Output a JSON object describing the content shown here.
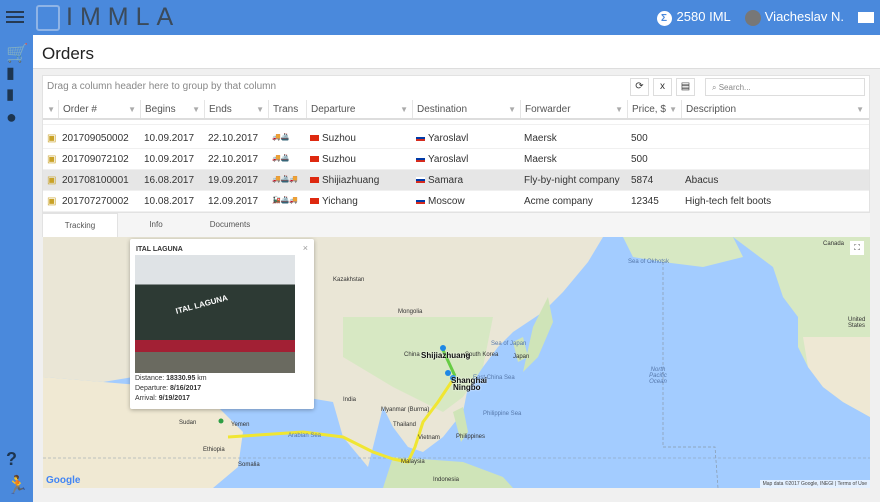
{
  "header": {
    "logo": "IMMLA",
    "balance": "2580 IML",
    "balance_icon": "sigma-icon",
    "user": "Viacheslav N."
  },
  "sidebar": {
    "icons": [
      "cart-icon",
      "document-icon",
      "chart-icon",
      "globe-icon"
    ],
    "help": "?",
    "bottom": "runner-icon"
  },
  "page": {
    "title": "Orders"
  },
  "grid": {
    "group_hint": "Drag a column header here to group by that column",
    "search_placeholder": "Search...",
    "columns": [
      "Order #",
      "Begins",
      "Ends",
      "Trans",
      "Departure",
      "Destination",
      "Forwarder",
      "Price, $",
      "Description"
    ],
    "rows": [
      {
        "order": "201709050002",
        "begins": "10.09.2017",
        "ends": "22.10.2017",
        "trans": "🚚🚢",
        "departure": "Suzhou",
        "destination": "Yaroslavl",
        "forwarder": "Maersk",
        "price": "500",
        "description": "",
        "selected": false
      },
      {
        "order": "201709072102",
        "begins": "10.09.2017",
        "ends": "22.10.2017",
        "trans": "🚚🚢",
        "departure": "Suzhou",
        "destination": "Yaroslavl",
        "forwarder": "Maersk",
        "price": "500",
        "description": "",
        "selected": false
      },
      {
        "order": "201708100001",
        "begins": "16.08.2017",
        "ends": "19.09.2017",
        "trans": "🚚🚢🚚",
        "departure": "Shijiazhuang",
        "destination": "Samara",
        "forwarder": "Fly-by-night company",
        "price": "5874",
        "description": "Abacus",
        "selected": true
      },
      {
        "order": "201707270002",
        "begins": "10.08.2017",
        "ends": "12.09.2017",
        "trans": "🚂🚢🚚",
        "departure": "Yichang",
        "destination": "Moscow",
        "forwarder": "Acme company",
        "price": "12345",
        "description": "High-tech felt boots",
        "selected": false
      }
    ]
  },
  "tabs": [
    "Tracking",
    "Info",
    "Documents"
  ],
  "map": {
    "popup": {
      "title": "ITAL LAGUNA",
      "ship_text": "ITAL LAGUNA",
      "distance_label": "Distance:",
      "distance": "18330.95",
      "distance_unit": "km",
      "departure_label": "Departure:",
      "departure": "8/16/2017",
      "arrival_label": "Arrival:",
      "arrival": "9/19/2017"
    },
    "cities": [
      "Shijiazhuang",
      "Shanghai",
      "Ningbo"
    ],
    "labels": [
      "Mongolia",
      "China",
      "South Korea",
      "Japan",
      "Sea of Japan",
      "East China Sea",
      "Philippine Sea",
      "Philippines",
      "Vietnam",
      "Thailand",
      "Myanmar (Burma)",
      "Malaysia",
      "Indonesia",
      "North Pacific Ocean",
      "Sea of Okhotsk",
      "Yemen",
      "Sudan",
      "Ethiopia",
      "Somalia",
      "Arabian Sea",
      "India",
      "Kazakhstan",
      "Canada",
      "United States"
    ],
    "attribution": "Map data ©2017 Google, INEGI",
    "terms": "Terms of Use",
    "google": "Google",
    "route_colors": {
      "sea": "#f0e632",
      "rail": "#66cc44",
      "point": "#1e88e5"
    }
  }
}
